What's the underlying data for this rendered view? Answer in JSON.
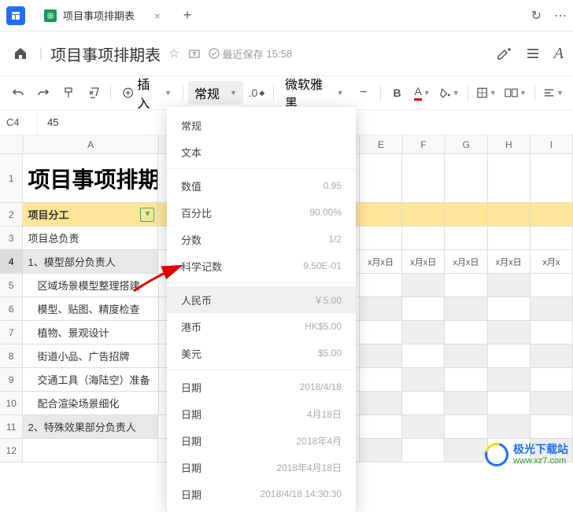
{
  "tab": {
    "title": "项目事项排期表",
    "close": "×",
    "new": "+"
  },
  "titlebar": {
    "doc_title": "项目事项排期表",
    "save_label": "最近保存",
    "save_time": "15:58"
  },
  "toolbar": {
    "insert": "插入",
    "format_current": "常规",
    "decimal": ".0",
    "font": "微软雅黑",
    "bold": "B",
    "fontcolor": "A"
  },
  "cellref": {
    "name": "C4",
    "value": "45"
  },
  "columns": [
    "A",
    "E",
    "F",
    "G",
    "H",
    "I"
  ],
  "rows": [
    {
      "n": "1",
      "a": "项目事项排期",
      "big": true
    },
    {
      "n": "2",
      "a": "项目分工",
      "yellow": true
    },
    {
      "n": "3",
      "a": "项目总负责"
    },
    {
      "n": "4",
      "a": "1、模型部分负责人",
      "grey": true,
      "sel": true,
      "dates": [
        "x月x日",
        "x月x日",
        "x月x日",
        "x月x日",
        "x月x"
      ]
    },
    {
      "n": "5",
      "a": "区域场景模型整理搭建",
      "indent": true
    },
    {
      "n": "6",
      "a": "模型、贴图、精度检查",
      "indent": true
    },
    {
      "n": "7",
      "a": "植物、景观设计",
      "indent": true
    },
    {
      "n": "8",
      "a": "街道小品、广告招牌",
      "indent": true
    },
    {
      "n": "9",
      "a": "交通工具（海陆空）准备",
      "indent": true
    },
    {
      "n": "10",
      "a": "配合渲染场景细化",
      "indent": true
    },
    {
      "n": "11",
      "a": "2、特殊效果部分负责人",
      "grey": true
    },
    {
      "n": "12",
      "a": ""
    }
  ],
  "dropdown": [
    {
      "label": "常规"
    },
    {
      "label": "文本"
    },
    {
      "sep": true
    },
    {
      "label": "数值",
      "val": "0.95"
    },
    {
      "label": "百分比",
      "val": "90.00%"
    },
    {
      "label": "分数",
      "val": "1/2"
    },
    {
      "label": "科学记数",
      "val": "9.50E-01"
    },
    {
      "sep": true
    },
    {
      "label": "人民币",
      "val": "￥5.00",
      "hl": true
    },
    {
      "label": "港币",
      "val": "HK$5.00"
    },
    {
      "label": "美元",
      "val": "$5.00"
    },
    {
      "sep": true
    },
    {
      "label": "日期",
      "val": "2018/4/18"
    },
    {
      "label": "日期",
      "val": "4月18日"
    },
    {
      "label": "日期",
      "val": "2018年4月"
    },
    {
      "label": "日期",
      "val": "2018年4月18日"
    },
    {
      "label": "日期",
      "val": "2018/4/18 14:30:30"
    }
  ],
  "watermark": {
    "cn": "极光下载站",
    "url": "www.xz7.com"
  }
}
